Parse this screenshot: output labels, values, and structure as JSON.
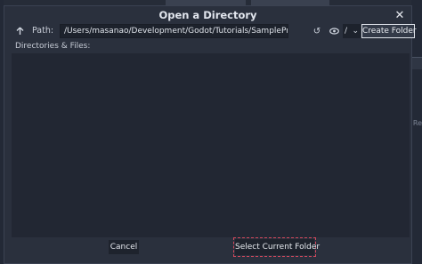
{
  "dialog": {
    "title": "Open a Directory",
    "close_glyph": "✕"
  },
  "toolbar": {
    "up_icon": "arrow-up-icon",
    "up_glyph": "🡑",
    "path_label": "Path:",
    "path_value": "/Users/masanao/Development/Godot/Tutorials/SampleProject",
    "refresh_icon": "refresh-icon",
    "refresh_glyph": "↺",
    "eye_icon": "eye-icon",
    "drive_value": "/",
    "drive_chevron": "⌄",
    "create_folder_label": "Create Folder"
  },
  "files": {
    "label": "Directories & Files:",
    "items": []
  },
  "footer": {
    "cancel_label": "Cancel",
    "select_label": "Select Current Folder"
  },
  "background": {
    "side_text": "Re"
  },
  "colors": {
    "dialog_bg": "#2a303d",
    "list_bg": "#222733",
    "focus_outline": "#d2485c"
  }
}
